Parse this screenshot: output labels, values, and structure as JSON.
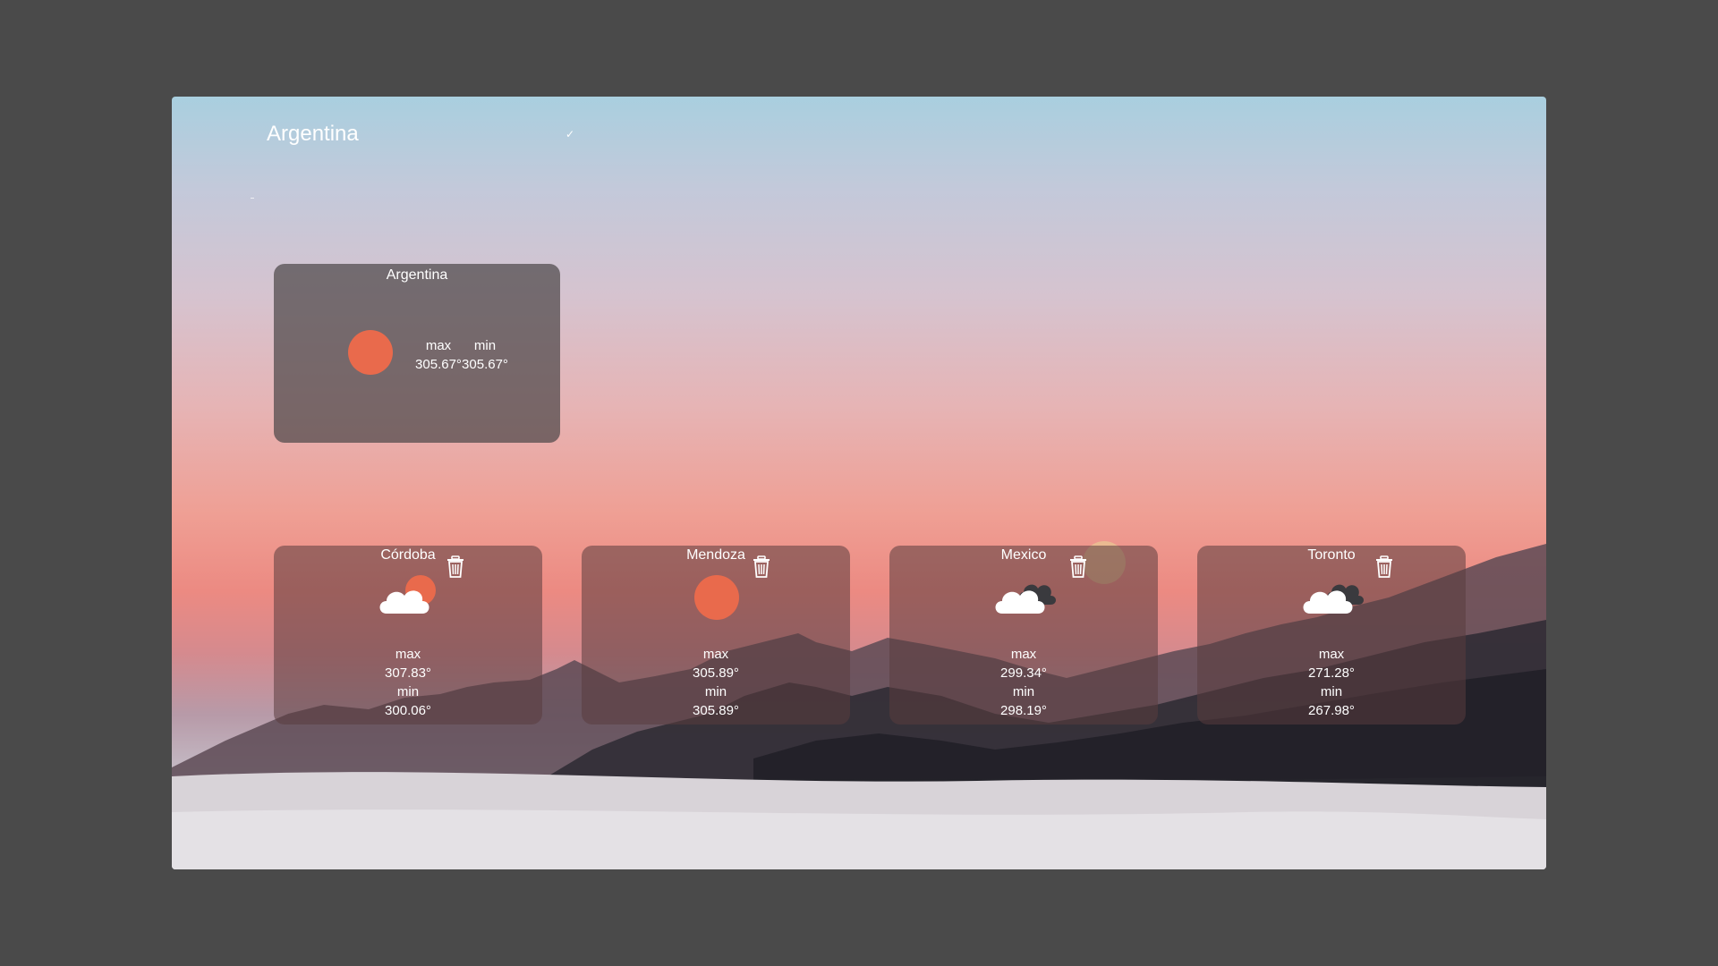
{
  "search": {
    "value": "Argentina",
    "submit_label": "✓"
  },
  "main_card": {
    "title": "Argentina",
    "icon": "sun-icon",
    "max_label": "max",
    "min_label": "min",
    "max": "305.67°",
    "min": "305.67°"
  },
  "cities": [
    {
      "name": "Córdoba",
      "icon": "cloud-sun-icon",
      "max_label": "max",
      "max": "307.83°",
      "min_label": "min",
      "min": "300.06°"
    },
    {
      "name": "Mendoza",
      "icon": "sun-icon",
      "max_label": "max",
      "max": "305.89°",
      "min_label": "min",
      "min": "305.89°"
    },
    {
      "name": "Mexico",
      "icon": "cloud-dark-icon",
      "max_label": "max",
      "max": "299.34°",
      "min_label": "min",
      "min": "298.19°"
    },
    {
      "name": "Toronto",
      "icon": "cloud-dark-icon",
      "max_label": "max",
      "max": "271.28°",
      "min_label": "min",
      "min": "267.98°"
    }
  ],
  "colors": {
    "sun": "#e96a4c",
    "cloud": "#ffffff",
    "dark_cloud": "#3a3a3e",
    "page_background": "#4a4a4a"
  }
}
